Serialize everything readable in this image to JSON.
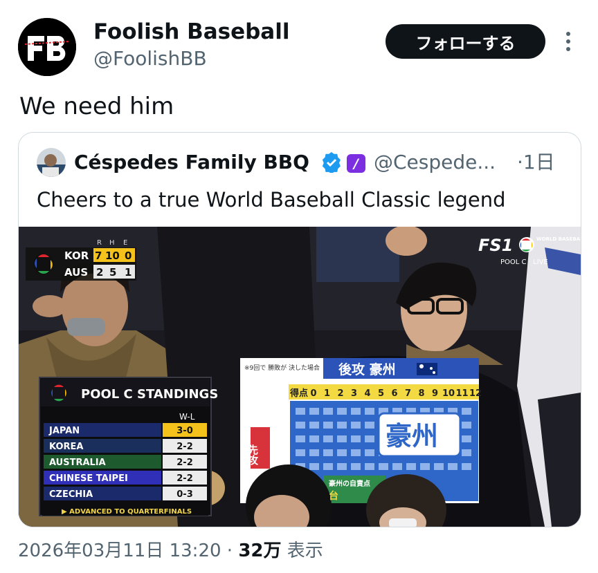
{
  "author": {
    "display_name": "Foolish Baseball",
    "handle": "@FoolishBB",
    "logo_text": "FB"
  },
  "follow_label": "フォローする",
  "tweet_text": "We need him",
  "quoted": {
    "display_name": "Céspedes Family BBQ",
    "handle": "@Cespede...",
    "time": "·1日",
    "label_badge": "/",
    "text": "Cheers to a true World Baseball Classic legend"
  },
  "broadcast": {
    "network": "FS1",
    "event": "WORLD BASEBALL CLASSIC",
    "feed": "POOL C · LIVE",
    "score_headers": [
      "R",
      "H",
      "E"
    ],
    "score_rows": [
      {
        "team": "KOR",
        "r": "7",
        "h": "10",
        "e": "0"
      },
      {
        "team": "AUS",
        "r": "2",
        "h": "5",
        "e": "1"
      }
    ],
    "standings_title": "POOL C STANDINGS",
    "standings_col": "W-L",
    "standings": [
      {
        "team": "JAPAN",
        "record": "3-0"
      },
      {
        "team": "KOREA",
        "record": "2-2"
      },
      {
        "team": "AUSTRALIA",
        "record": "2-2"
      },
      {
        "team": "CHINESE TAIPEI",
        "record": "2-2"
      },
      {
        "team": "CZECHIA",
        "record": "0-3"
      }
    ],
    "standings_footer": "▶ ADVANCED TO QUARTERFINALS",
    "sign": {
      "corner_note": "※9回で 勝敗が 決した場合",
      "header": "後攻 豪州",
      "score_label": "得点",
      "innings": [
        "0",
        "1",
        "2",
        "3",
        "4",
        "5",
        "6",
        "7",
        "8",
        "9",
        "10",
        "11",
        "12"
      ],
      "side_label": "先攻",
      "big_text": "豪州",
      "bottom_label": "豪州の自責点",
      "bottom_chars": "台"
    }
  },
  "footer": {
    "datetime": "2026年03月11日 13:20 · ",
    "views": "32万",
    "views_label": " 表示"
  },
  "colors": {
    "text": "#0f1419",
    "secondary": "#536471",
    "verified": "#1d9bf0",
    "label_badge": "#7b2fe0"
  }
}
